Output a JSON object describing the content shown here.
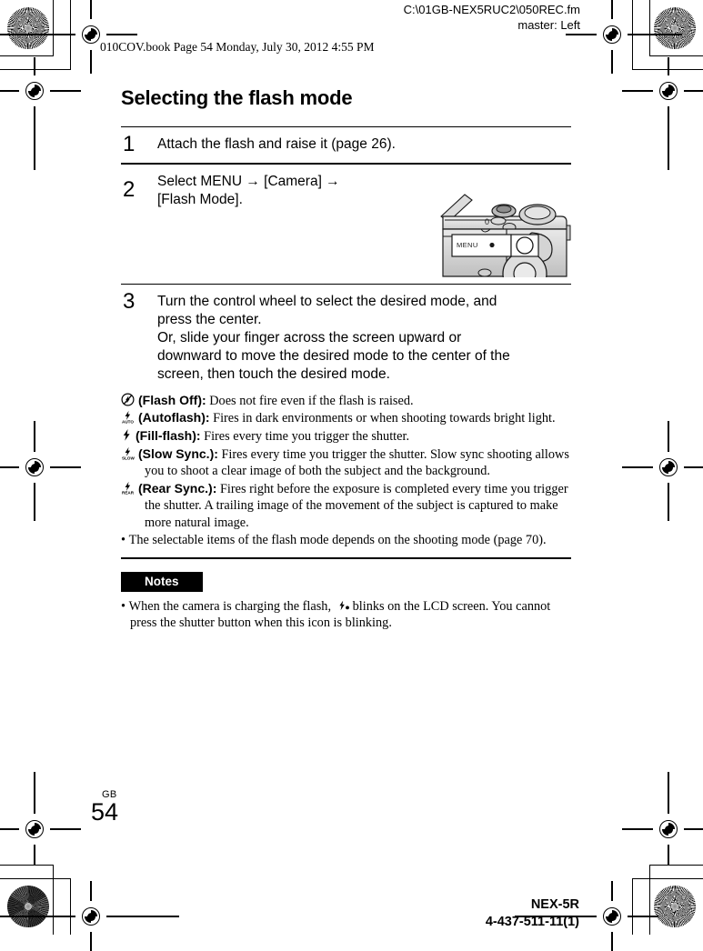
{
  "header": {
    "file_path": "C:\\01GB-NEX5RUC2\\050REC.fm",
    "master": "master: Left",
    "book_line": "010COV.book  Page 54  Monday, July 30, 2012  4:55 PM"
  },
  "content": {
    "title": "Selecting the flash mode",
    "steps": [
      {
        "number": "1",
        "lines": [
          "Attach the flash and raise it (page 26)."
        ]
      },
      {
        "number": "2",
        "lines": [
          "Select MENU → [Camera] →",
          "[Flash Mode]."
        ],
        "illustration_label": "MENU"
      },
      {
        "number": "3",
        "lines": [
          "Turn the control wheel to select the desired mode, and",
          "press the center.",
          "Or, slide your finger across the screen upward or",
          "downward to move the desired mode to the center of the",
          "screen, then touch the desired mode."
        ]
      }
    ],
    "flash_modes": [
      {
        "icon": "flash-off-icon",
        "label": "(Flash Off):",
        "description": "Does not fire even if the flash is raised."
      },
      {
        "icon": "flash-auto-icon",
        "label": "(Autoflash):",
        "description": "Fires in dark environments or when shooting towards bright light."
      },
      {
        "icon": "flash-fill-icon",
        "label": "(Fill-flash):",
        "description": "Fires every time you trigger the shutter."
      },
      {
        "icon": "flash-slow-sync-icon",
        "label": "(Slow Sync.):",
        "description": "Fires every time you trigger the shutter. Slow sync shooting allows you to shoot a clear image of both the subject and the background."
      },
      {
        "icon": "flash-rear-sync-icon",
        "label": "(Rear Sync.):",
        "description": "Fires right before the exposure is completed every time you trigger the shutter. A trailing image of the movement of the subject is captured to make more natural image."
      }
    ],
    "bullet_note": "The selectable items of the flash mode depends on the shooting mode (page 70).",
    "notes": {
      "tag": "Notes",
      "items": [
        "When the camera is charging the flash,  blinks on the LCD screen. You cannot press the shutter button when this icon is blinking."
      ],
      "item_prefix": "When the camera is charging the flash,",
      "item_suffix": "blinks on the LCD screen. You cannot press the shutter button when this icon is blinking."
    }
  },
  "footer": {
    "region_code": "GB",
    "page_number": "54",
    "model": "NEX-5R",
    "part_number": "4-437-511-11(1)"
  },
  "colors": {
    "ink": "#000000",
    "paper": "#ffffff",
    "notes_tag_bg": "#000000",
    "notes_tag_fg": "#ffffff"
  }
}
